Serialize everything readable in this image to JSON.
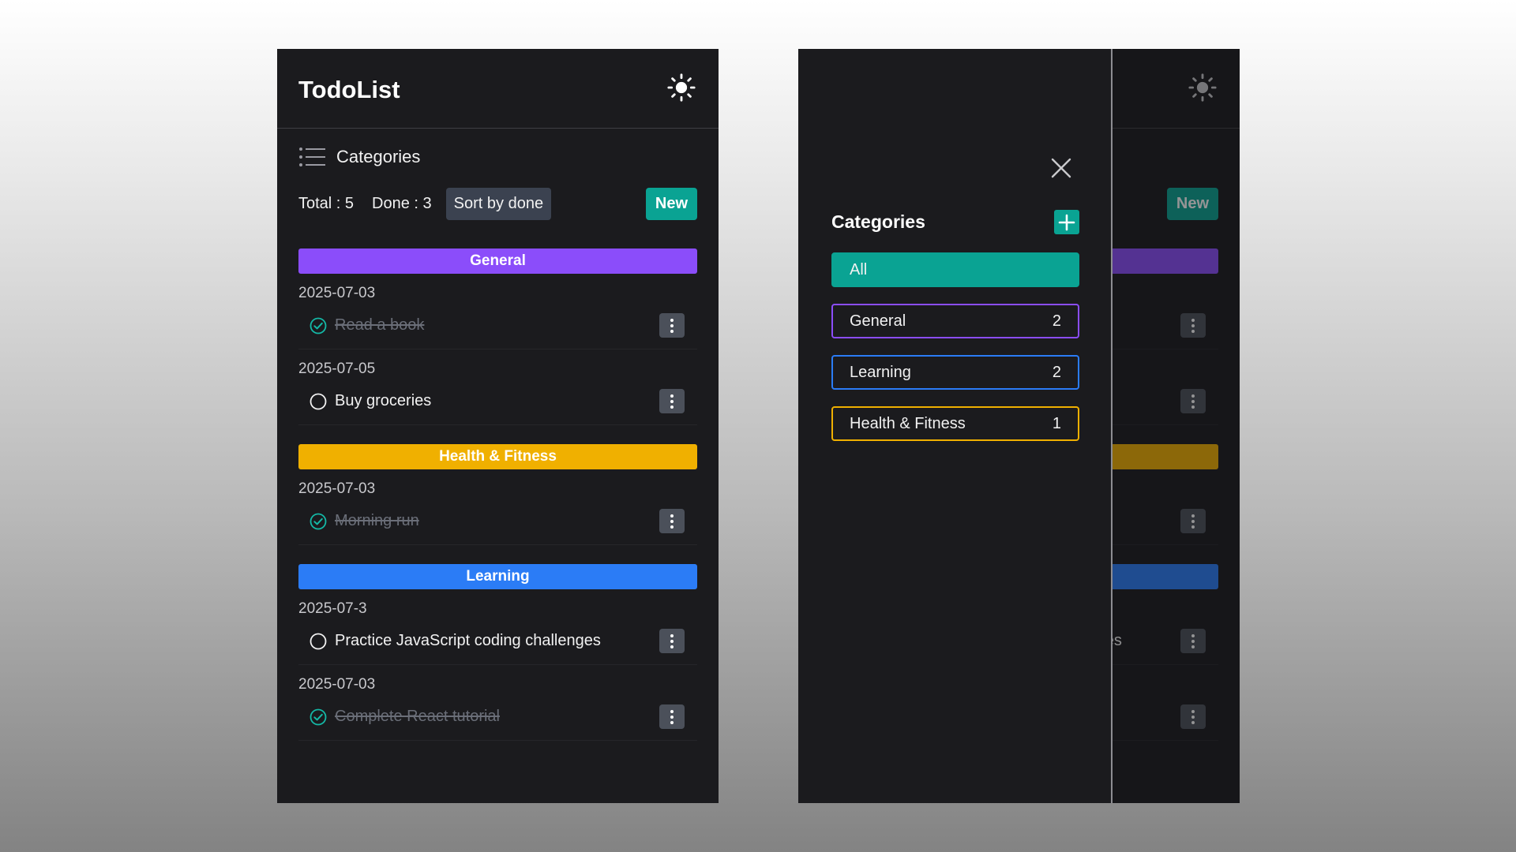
{
  "app": {
    "title": "TodoList",
    "theme_icon": "sun-icon",
    "categories_toggle": "Categories",
    "stats": {
      "total_label": "Total : 5",
      "done_label": "Done : 3"
    },
    "sort_label": "Sort by done",
    "new_label": "New"
  },
  "groups": [
    {
      "name": "General",
      "color": "#8b4dfa",
      "todos": [
        {
          "date": "2025-07-03",
          "text": "Read a book",
          "done": true
        },
        {
          "date": "2025-07-05",
          "text": "Buy groceries",
          "done": false
        }
      ]
    },
    {
      "name": "Health & Fitness",
      "color": "#f0b000",
      "todos": [
        {
          "date": "2025-07-03",
          "text": "Morning run",
          "done": true
        }
      ]
    },
    {
      "name": "Learning",
      "color": "#2b7cf6",
      "todos": [
        {
          "date": "2025-07-3",
          "text": "Practice JavaScript coding challenges",
          "done": false
        },
        {
          "date": "2025-07-03",
          "text": "Complete React tutorial",
          "done": true
        }
      ]
    }
  ],
  "drawer": {
    "title": "Categories",
    "close_icon": "close-icon",
    "add_icon": "plus-icon",
    "items": [
      {
        "label": "All",
        "count": "",
        "active": true,
        "color": "#0aa393"
      },
      {
        "label": "General",
        "count": "2",
        "active": false,
        "color": "#8b4dfa"
      },
      {
        "label": "Learning",
        "count": "2",
        "active": false,
        "color": "#2b7cf6"
      },
      {
        "label": "Health & Fitness",
        "count": "1",
        "active": false,
        "color": "#f0b000"
      }
    ]
  }
}
